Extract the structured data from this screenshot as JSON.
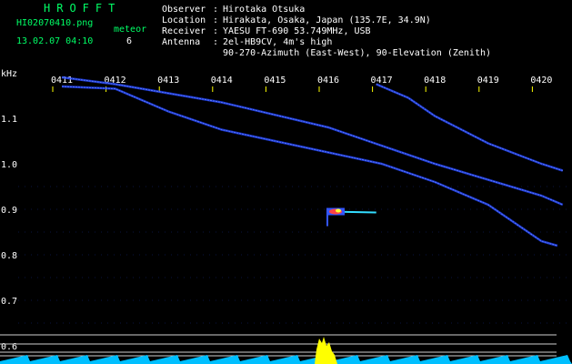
{
  "header": {
    "brand": "HROFFT",
    "filename": "HI02070410.png",
    "datetime": "13.02.07 04:10",
    "meteor_label": "meteor",
    "meteor_count": "6",
    "info": [
      {
        "key": "Observer",
        "value": "Hirotaka Otsuka"
      },
      {
        "key": "Location",
        "value": "Hirakata, Osaka, Japan (135.7E, 34.9N)"
      },
      {
        "key": "Receiver",
        "value": "YAESU FT-690 53.749MHz, USB"
      },
      {
        "key": "Antenna",
        "value": "2el-HB9CV, 4m's high"
      }
    ],
    "antenna_line2": "90-270-Azimuth (East-West), 90-Elevation (Zenith)",
    "separator": ":"
  },
  "chart_data": {
    "type": "heatmap",
    "title": "",
    "ylabel": "kHz",
    "xlabel": "",
    "x_ticks": [
      "0411",
      "0412",
      "0413",
      "0414",
      "0415",
      "0416",
      "0417",
      "0418",
      "0419",
      "0420"
    ],
    "y_ticks": [
      1.1,
      1.0,
      0.9,
      0.8,
      0.7,
      0.6
    ],
    "ylim": [
      0.57,
      1.19
    ],
    "series": [
      {
        "points": [
          [
            0,
            1.17
          ],
          [
            1,
            1.165
          ],
          [
            2,
            1.115
          ],
          [
            3,
            1.075
          ],
          [
            4,
            1.05
          ],
          [
            5,
            1.025
          ],
          [
            6,
            1.0
          ],
          [
            7,
            0.96
          ],
          [
            8,
            0.91
          ],
          [
            9,
            0.83
          ],
          [
            9.3,
            0.82
          ]
        ]
      },
      {
        "points": [
          [
            0,
            1.19
          ],
          [
            1,
            1.175
          ],
          [
            3,
            1.135
          ],
          [
            5,
            1.08
          ],
          [
            7,
            1.0
          ],
          [
            9,
            0.93
          ],
          [
            9.4,
            0.91
          ]
        ]
      },
      {
        "points": [
          [
            5.9,
            1.175
          ],
          [
            6.5,
            1.145
          ],
          [
            7,
            1.105
          ],
          [
            8,
            1.045
          ],
          [
            9,
            1.0
          ],
          [
            9.4,
            0.985
          ]
        ]
      }
    ],
    "meteor": {
      "x": 5.0,
      "y": 0.895,
      "tail_end_x": 5.9
    },
    "grid": false,
    "colors": {
      "trace": "#2244ff",
      "trace_core": "#6688ff",
      "axis_text": "#ffffff",
      "tick": "#ffff00",
      "header_label": "#00ff66",
      "spectrum_fill": "#00bfff",
      "spectrum_peak": "#ffff00",
      "level_line": "#d0d0d0"
    }
  }
}
